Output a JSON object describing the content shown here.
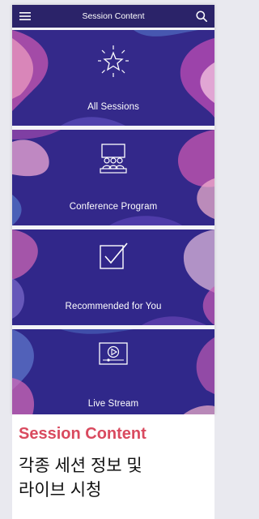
{
  "header": {
    "title": "Session Content",
    "menu_icon": "hamburger-menu-icon",
    "search_icon": "search-icon"
  },
  "tiles": [
    {
      "label": "All Sessions",
      "icon": "star-burst-icon"
    },
    {
      "label": "Conference Program",
      "icon": "audience-presentation-icon"
    },
    {
      "label": "Recommended for You",
      "icon": "checkbox-check-icon"
    },
    {
      "label": "Live Stream",
      "icon": "video-player-icon"
    }
  ],
  "caption": {
    "heading": "Session Content",
    "description": "각종 세션 정보 및\n라이브 시청"
  },
  "colors": {
    "header_bg": "#2b2369",
    "tile_bg": "#332a86",
    "accent_heading": "#d94a5f"
  }
}
